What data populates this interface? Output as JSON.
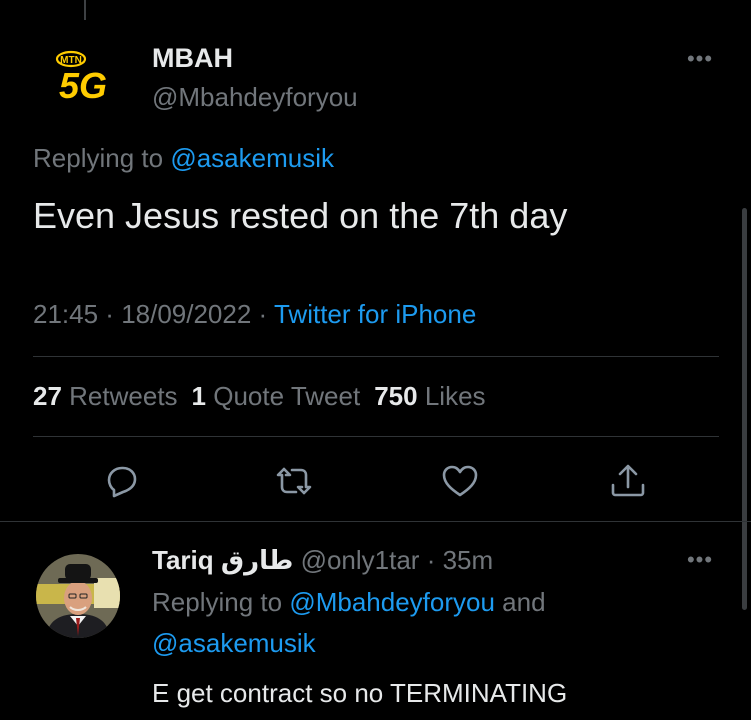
{
  "tweet": {
    "author_name": "MBAH",
    "author_handle": "@Mbahdeyforyou",
    "avatar_logo": {
      "badge": "MTN",
      "text": "5G"
    },
    "replying_prefix": "Replying to ",
    "replying_to": "@asakemusik",
    "text": "Even Jesus rested on the 7th day",
    "time": "21:45",
    "sep1": " · ",
    "date": "18/09/2022",
    "sep2": " · ",
    "source": "Twitter for iPhone",
    "stats": {
      "retweets_count": "27",
      "retweets_label": "Retweets",
      "quotes_count": "1",
      "quotes_label": "Quote Tweet",
      "likes_count": "750",
      "likes_label": "Likes"
    },
    "more": "•••",
    "actions": [
      "reply-icon",
      "retweet-icon",
      "like-icon",
      "share-icon"
    ]
  },
  "reply": {
    "name": "Tariq طارق",
    "handle": "@only1tar",
    "sep": " · ",
    "time": "35m",
    "replying_prefix": "Replying to ",
    "mention1": "@Mbahdeyforyou",
    "and": " and",
    "mention2": "@asakemusik",
    "text": "E get contract so no TERMINATING",
    "more": "•••"
  },
  "colors": {
    "background": "#000000",
    "text": "#e7e9ea",
    "muted": "#71767b",
    "link": "#1d9bf0",
    "divider": "#2f3336",
    "logo_yellow": "#ffcc00"
  }
}
